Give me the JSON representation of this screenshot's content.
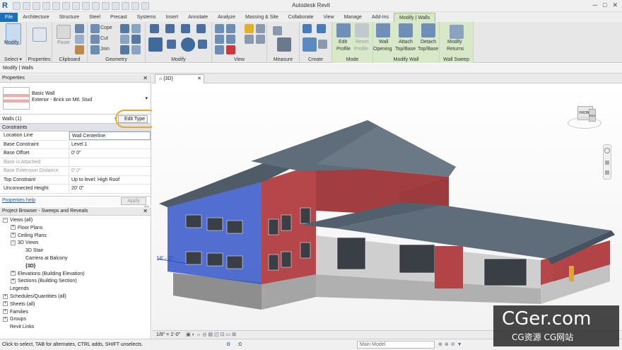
{
  "app": {
    "title": "Autodesk Revit",
    "logo": "R"
  },
  "ribbon_tabs": [
    "File",
    "Architecture",
    "Structure",
    "Steel",
    "Precast",
    "Systems",
    "Insert",
    "Annotate",
    "Analyze",
    "Massing & Site",
    "Collaborate",
    "View",
    "Manage",
    "Add-Ins",
    "Modify | Walls"
  ],
  "ribbon": {
    "modify": "Modify",
    "select": "Select ▾",
    "properties": "Properties",
    "clipboard": "Clipboard",
    "paste": "Paste",
    "cope": "Cope",
    "cut": "Cut",
    "join": "Join",
    "geometry": "Geometry",
    "modify_panel": "Modify",
    "view": "View",
    "measure": "Measure",
    "create": "Create",
    "mode": "Mode",
    "edit_profile_1": "Edit",
    "edit_profile_2": "Profile",
    "reset_profile_1": "Reset",
    "reset_profile_2": "Profile",
    "wall_opening_1": "Wall",
    "wall_opening_2": "Opening",
    "attach_1": "Attach",
    "attach_2": "Top/Base",
    "detach_1": "Detach",
    "detach_2": "Top/Base",
    "modify_wall": "Modify Wall",
    "modify_returns_1": "Modify",
    "modify_returns_2": "Returns",
    "wall_sweep": "Wall Sweep"
  },
  "context_bar": "Modify | Walls",
  "properties": {
    "title": "Properties",
    "type_name": "Basic Wall",
    "type_sub": "Exterior - Brick on Mtl. Stud",
    "selection": "Walls (1)",
    "edit_type": "Edit Type",
    "section": "Constraints",
    "rows": [
      {
        "k": "Location Line",
        "v": "Wall Centerline"
      },
      {
        "k": "Base Constraint",
        "v": "Level 1"
      },
      {
        "k": "Base Offset",
        "v": "0'  0\""
      },
      {
        "k": "Base is Attached",
        "v": ""
      },
      {
        "k": "Base Extension Distance",
        "v": "0'  0\""
      },
      {
        "k": "Top Constraint",
        "v": "Up to level: High Roof"
      },
      {
        "k": "Unconnected Height",
        "v": "20'  0\""
      }
    ],
    "help": "Properties help",
    "apply": "Apply"
  },
  "browser": {
    "title": "Project Browser - Sweeps and Reveals",
    "items": [
      {
        "label": "Views (all)",
        "level": 0,
        "tog": "−"
      },
      {
        "label": "Floor Plans",
        "level": 1,
        "tog": "+"
      },
      {
        "label": "Ceiling Plans",
        "level": 1,
        "tog": "+"
      },
      {
        "label": "3D Views",
        "level": 1,
        "tog": "−"
      },
      {
        "label": "3D Stair",
        "level": 2,
        "tog": ""
      },
      {
        "label": "Camera at Balcony",
        "level": 2,
        "tog": ""
      },
      {
        "label": "{3D}",
        "level": 2,
        "tog": "",
        "bold": true
      },
      {
        "label": "Elevations (Building Elevation)",
        "level": 1,
        "tog": "+"
      },
      {
        "label": "Sections (Building Section)",
        "level": 1,
        "tog": "+"
      },
      {
        "label": "Legends",
        "level": 0,
        "tog": ""
      },
      {
        "label": "Schedules/Quantities (all)",
        "level": 0,
        "tog": "+"
      },
      {
        "label": "Sheets (all)",
        "level": 0,
        "tog": "+"
      },
      {
        "label": "Families",
        "level": 0,
        "tog": "+"
      },
      {
        "label": "Groups",
        "level": 0,
        "tog": "+"
      },
      {
        "label": "Revit Links",
        "level": 0,
        "tog": ""
      }
    ]
  },
  "view": {
    "tab": "{3D}",
    "dimension": "16' - 0\"",
    "viewcube_face1": "FRONT",
    "viewcube_face2": "RIGHT",
    "scale": "1/8\" = 1'-0\""
  },
  "status": {
    "hint": "Click to select, TAB for alternates, CTRL adds, SHIFT unselects.",
    "zero": ":0",
    "model": "Main Model"
  },
  "watermark": {
    "line1": "CGer.com",
    "line2": "CG资源  CG网站"
  },
  "colors": {
    "accent": "#1c6fb8",
    "selection": "#2d4fc8",
    "brick": "#b5474a",
    "roof": "#5a6876",
    "highlight": "#e8a53a"
  }
}
